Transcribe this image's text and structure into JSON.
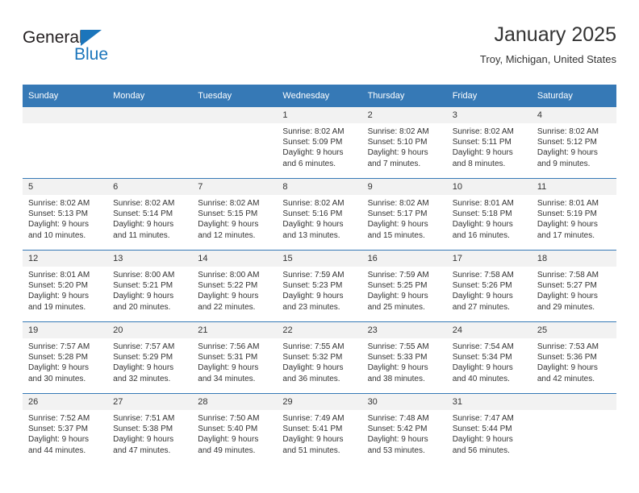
{
  "logo": {
    "word1": "General",
    "word2": "Blue",
    "triangle_color": "#1b75bb",
    "word1_color": "#231f20",
    "word2_color": "#1b75bb"
  },
  "header": {
    "title": "January 2025",
    "subtitle": "Troy, Michigan, United States"
  },
  "theme": {
    "header_bg": "#3679b6",
    "header_text": "#ffffff",
    "daynum_bg": "#f2f2f2",
    "grid_line": "#3679b6",
    "body_text": "#333333"
  },
  "columns": [
    "Sunday",
    "Monday",
    "Tuesday",
    "Wednesday",
    "Thursday",
    "Friday",
    "Saturday"
  ],
  "labels": {
    "sunrise_prefix": "Sunrise: ",
    "sunset_prefix": "Sunset: ",
    "daylight_prefix": "Daylight: "
  },
  "weeks": [
    [
      {
        "day": "",
        "empty": true,
        "l1": "",
        "l2": "",
        "l3": "",
        "l4": ""
      },
      {
        "day": "",
        "empty": true,
        "l1": "",
        "l2": "",
        "l3": "",
        "l4": ""
      },
      {
        "day": "",
        "empty": true,
        "l1": "",
        "l2": "",
        "l3": "",
        "l4": ""
      },
      {
        "day": "1",
        "empty": false,
        "l1": "Sunrise: 8:02 AM",
        "l2": "Sunset: 5:09 PM",
        "l3": "Daylight: 9 hours",
        "l4": "and 6 minutes."
      },
      {
        "day": "2",
        "empty": false,
        "l1": "Sunrise: 8:02 AM",
        "l2": "Sunset: 5:10 PM",
        "l3": "Daylight: 9 hours",
        "l4": "and 7 minutes."
      },
      {
        "day": "3",
        "empty": false,
        "l1": "Sunrise: 8:02 AM",
        "l2": "Sunset: 5:11 PM",
        "l3": "Daylight: 9 hours",
        "l4": "and 8 minutes."
      },
      {
        "day": "4",
        "empty": false,
        "l1": "Sunrise: 8:02 AM",
        "l2": "Sunset: 5:12 PM",
        "l3": "Daylight: 9 hours",
        "l4": "and 9 minutes."
      }
    ],
    [
      {
        "day": "5",
        "empty": false,
        "l1": "Sunrise: 8:02 AM",
        "l2": "Sunset: 5:13 PM",
        "l3": "Daylight: 9 hours",
        "l4": "and 10 minutes."
      },
      {
        "day": "6",
        "empty": false,
        "l1": "Sunrise: 8:02 AM",
        "l2": "Sunset: 5:14 PM",
        "l3": "Daylight: 9 hours",
        "l4": "and 11 minutes."
      },
      {
        "day": "7",
        "empty": false,
        "l1": "Sunrise: 8:02 AM",
        "l2": "Sunset: 5:15 PM",
        "l3": "Daylight: 9 hours",
        "l4": "and 12 minutes."
      },
      {
        "day": "8",
        "empty": false,
        "l1": "Sunrise: 8:02 AM",
        "l2": "Sunset: 5:16 PM",
        "l3": "Daylight: 9 hours",
        "l4": "and 13 minutes."
      },
      {
        "day": "9",
        "empty": false,
        "l1": "Sunrise: 8:02 AM",
        "l2": "Sunset: 5:17 PM",
        "l3": "Daylight: 9 hours",
        "l4": "and 15 minutes."
      },
      {
        "day": "10",
        "empty": false,
        "l1": "Sunrise: 8:01 AM",
        "l2": "Sunset: 5:18 PM",
        "l3": "Daylight: 9 hours",
        "l4": "and 16 minutes."
      },
      {
        "day": "11",
        "empty": false,
        "l1": "Sunrise: 8:01 AM",
        "l2": "Sunset: 5:19 PM",
        "l3": "Daylight: 9 hours",
        "l4": "and 17 minutes."
      }
    ],
    [
      {
        "day": "12",
        "empty": false,
        "l1": "Sunrise: 8:01 AM",
        "l2": "Sunset: 5:20 PM",
        "l3": "Daylight: 9 hours",
        "l4": "and 19 minutes."
      },
      {
        "day": "13",
        "empty": false,
        "l1": "Sunrise: 8:00 AM",
        "l2": "Sunset: 5:21 PM",
        "l3": "Daylight: 9 hours",
        "l4": "and 20 minutes."
      },
      {
        "day": "14",
        "empty": false,
        "l1": "Sunrise: 8:00 AM",
        "l2": "Sunset: 5:22 PM",
        "l3": "Daylight: 9 hours",
        "l4": "and 22 minutes."
      },
      {
        "day": "15",
        "empty": false,
        "l1": "Sunrise: 7:59 AM",
        "l2": "Sunset: 5:23 PM",
        "l3": "Daylight: 9 hours",
        "l4": "and 23 minutes."
      },
      {
        "day": "16",
        "empty": false,
        "l1": "Sunrise: 7:59 AM",
        "l2": "Sunset: 5:25 PM",
        "l3": "Daylight: 9 hours",
        "l4": "and 25 minutes."
      },
      {
        "day": "17",
        "empty": false,
        "l1": "Sunrise: 7:58 AM",
        "l2": "Sunset: 5:26 PM",
        "l3": "Daylight: 9 hours",
        "l4": "and 27 minutes."
      },
      {
        "day": "18",
        "empty": false,
        "l1": "Sunrise: 7:58 AM",
        "l2": "Sunset: 5:27 PM",
        "l3": "Daylight: 9 hours",
        "l4": "and 29 minutes."
      }
    ],
    [
      {
        "day": "19",
        "empty": false,
        "l1": "Sunrise: 7:57 AM",
        "l2": "Sunset: 5:28 PM",
        "l3": "Daylight: 9 hours",
        "l4": "and 30 minutes."
      },
      {
        "day": "20",
        "empty": false,
        "l1": "Sunrise: 7:57 AM",
        "l2": "Sunset: 5:29 PM",
        "l3": "Daylight: 9 hours",
        "l4": "and 32 minutes."
      },
      {
        "day": "21",
        "empty": false,
        "l1": "Sunrise: 7:56 AM",
        "l2": "Sunset: 5:31 PM",
        "l3": "Daylight: 9 hours",
        "l4": "and 34 minutes."
      },
      {
        "day": "22",
        "empty": false,
        "l1": "Sunrise: 7:55 AM",
        "l2": "Sunset: 5:32 PM",
        "l3": "Daylight: 9 hours",
        "l4": "and 36 minutes."
      },
      {
        "day": "23",
        "empty": false,
        "l1": "Sunrise: 7:55 AM",
        "l2": "Sunset: 5:33 PM",
        "l3": "Daylight: 9 hours",
        "l4": "and 38 minutes."
      },
      {
        "day": "24",
        "empty": false,
        "l1": "Sunrise: 7:54 AM",
        "l2": "Sunset: 5:34 PM",
        "l3": "Daylight: 9 hours",
        "l4": "and 40 minutes."
      },
      {
        "day": "25",
        "empty": false,
        "l1": "Sunrise: 7:53 AM",
        "l2": "Sunset: 5:36 PM",
        "l3": "Daylight: 9 hours",
        "l4": "and 42 minutes."
      }
    ],
    [
      {
        "day": "26",
        "empty": false,
        "l1": "Sunrise: 7:52 AM",
        "l2": "Sunset: 5:37 PM",
        "l3": "Daylight: 9 hours",
        "l4": "and 44 minutes."
      },
      {
        "day": "27",
        "empty": false,
        "l1": "Sunrise: 7:51 AM",
        "l2": "Sunset: 5:38 PM",
        "l3": "Daylight: 9 hours",
        "l4": "and 47 minutes."
      },
      {
        "day": "28",
        "empty": false,
        "l1": "Sunrise: 7:50 AM",
        "l2": "Sunset: 5:40 PM",
        "l3": "Daylight: 9 hours",
        "l4": "and 49 minutes."
      },
      {
        "day": "29",
        "empty": false,
        "l1": "Sunrise: 7:49 AM",
        "l2": "Sunset: 5:41 PM",
        "l3": "Daylight: 9 hours",
        "l4": "and 51 minutes."
      },
      {
        "day": "30",
        "empty": false,
        "l1": "Sunrise: 7:48 AM",
        "l2": "Sunset: 5:42 PM",
        "l3": "Daylight: 9 hours",
        "l4": "and 53 minutes."
      },
      {
        "day": "31",
        "empty": false,
        "l1": "Sunrise: 7:47 AM",
        "l2": "Sunset: 5:44 PM",
        "l3": "Daylight: 9 hours",
        "l4": "and 56 minutes."
      },
      {
        "day": "",
        "empty": true,
        "l1": "",
        "l2": "",
        "l3": "",
        "l4": ""
      }
    ]
  ]
}
